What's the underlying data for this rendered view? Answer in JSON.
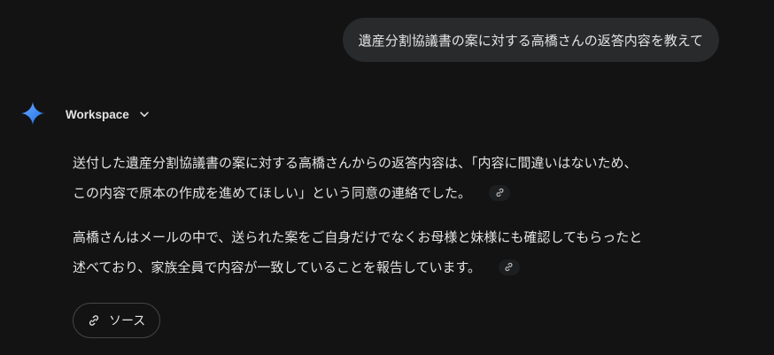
{
  "user_query": {
    "text": "遺産分割協議書の案に対する高橋さんの返答内容を教えて"
  },
  "model": {
    "name": "Workspace",
    "icon": "gemini-sparkle-icon",
    "dropdown_icon": "chevron-down-icon"
  },
  "response": {
    "paragraphs": [
      {
        "lines": [
          "送付した遺産分割協議書の案に対する高橋さんからの返答内容は、「内容に間違いはないため、",
          "この内容で原本の作成を進めてほしい」という同意の連絡でした。"
        ],
        "citation_icon": "link-icon"
      },
      {
        "lines": [
          "高橋さんはメールの中で、送られた案をご自身だけでなくお母様と妹様にも確認してもらったと",
          "述べており、家族全員で内容が一致していることを報告しています。"
        ],
        "citation_icon": "link-icon"
      }
    ]
  },
  "sources_button": {
    "label": "ソース",
    "icon": "link-icon"
  },
  "colors": {
    "background": "#131314",
    "bubble": "#282a2c",
    "text": "#e3e3e3",
    "gemini_gradient_start": "#4c8df6",
    "gemini_gradient_end": "#1a73e8"
  }
}
